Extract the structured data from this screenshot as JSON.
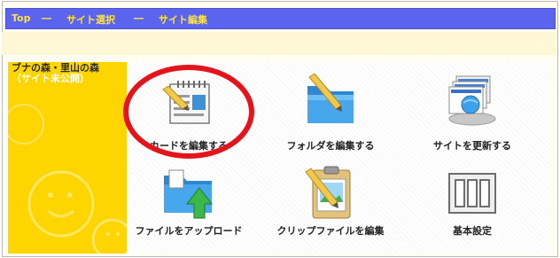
{
  "nav": {
    "top": "Top",
    "sep1": "―",
    "site_select": "サイト選択",
    "sep2": "―",
    "site_edit": "サイト編集"
  },
  "sidebar": {
    "site_name": "ブナの森・里山の森",
    "site_status": "（サイト未公開）"
  },
  "tiles": [
    {
      "label": "カードを編集する",
      "icon": "card-edit-icon"
    },
    {
      "label": "フォルダを編集する",
      "icon": "folder-edit-icon"
    },
    {
      "label": "サイトを更新する",
      "icon": "site-update-icon"
    },
    {
      "label": "ファイルをアップロード",
      "icon": "file-upload-icon"
    },
    {
      "label": "クリップファイルを編集",
      "icon": "clip-file-edit-icon"
    },
    {
      "label": "基本設定",
      "icon": "basic-settings-icon"
    }
  ],
  "colors": {
    "nav_bg": "#5a64ee",
    "nav_text": "#ffe23a",
    "sidebar_bg": "#ffd500",
    "highlight_ring": "#e4141b"
  }
}
